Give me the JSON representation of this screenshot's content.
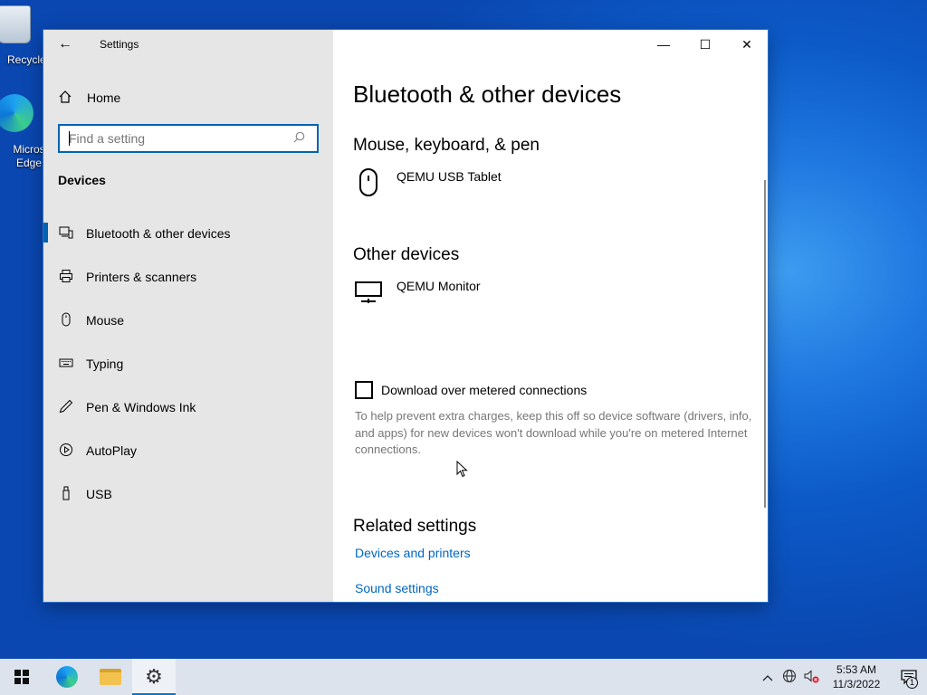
{
  "desktop": {
    "icons": [
      {
        "label": "Recycle"
      },
      {
        "label": "Micros Edge"
      }
    ]
  },
  "window": {
    "title": "Settings",
    "controls": {
      "minimize": "—",
      "maximize": "☐",
      "close": "✕"
    }
  },
  "sidebar": {
    "home_label": "Home",
    "search": {
      "placeholder": "Find a setting"
    },
    "section_title": "Devices",
    "items": [
      {
        "label": "Bluetooth & other devices",
        "icon": "bluetooth-devices-icon",
        "active": true
      },
      {
        "label": "Printers & scanners",
        "icon": "printer-icon",
        "active": false
      },
      {
        "label": "Mouse",
        "icon": "mouse-icon",
        "active": false
      },
      {
        "label": "Typing",
        "icon": "keyboard-icon",
        "active": false
      },
      {
        "label": "Pen & Windows Ink",
        "icon": "pen-icon",
        "active": false
      },
      {
        "label": "AutoPlay",
        "icon": "autoplay-icon",
        "active": false
      },
      {
        "label": "USB",
        "icon": "usb-icon",
        "active": false
      }
    ]
  },
  "main": {
    "page_title": "Bluetooth & other devices",
    "mouse_section": {
      "title": "Mouse, keyboard, & pen",
      "devices": [
        {
          "name": "QEMU USB Tablet"
        }
      ]
    },
    "other_section": {
      "title": "Other devices",
      "devices": [
        {
          "name": "QEMU Monitor"
        }
      ]
    },
    "metered": {
      "label": "Download over metered connections",
      "checked": false,
      "description": "To help prevent extra charges, keep this off so device software (drivers, info, and apps) for new devices won't download while you're on metered Internet connections."
    },
    "related": {
      "title": "Related settings",
      "links": [
        "Devices and printers",
        "Sound settings"
      ]
    }
  },
  "taskbar": {
    "clock": {
      "time": "5:53 AM",
      "date": "11/3/2022"
    },
    "notification_count": "1"
  },
  "colors": {
    "accent": "#0063b1",
    "link": "#0067c0",
    "sidebar_bg": "#e6e6e6"
  }
}
